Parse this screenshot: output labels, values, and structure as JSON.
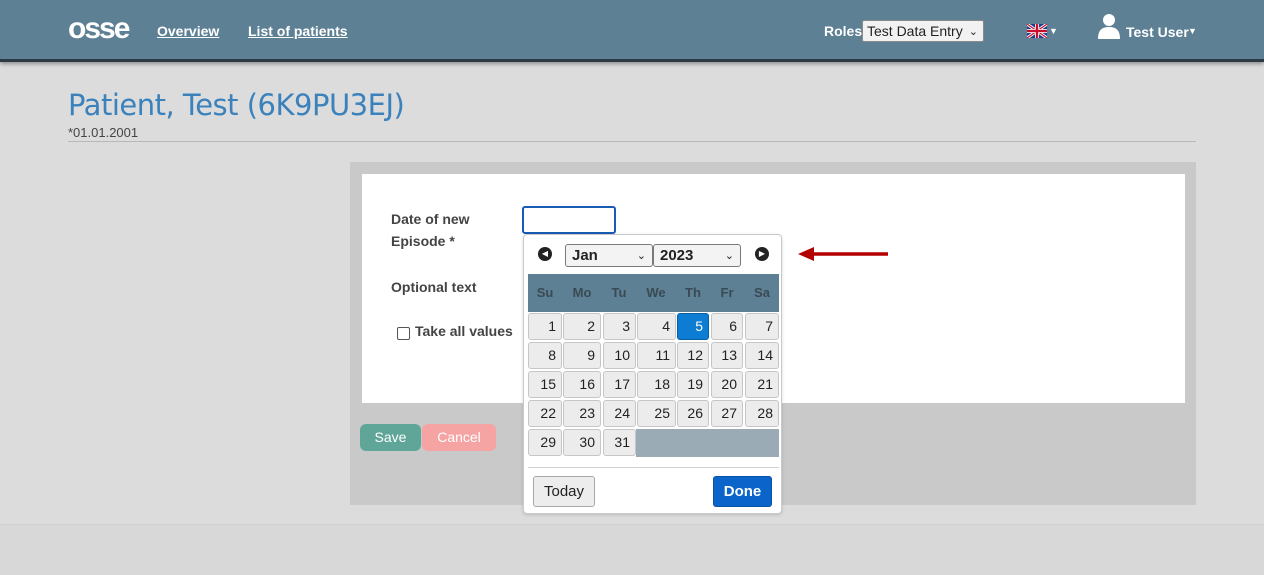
{
  "header": {
    "logo": "osse",
    "nav": [
      {
        "label": "Overview"
      },
      {
        "label": "List of patients"
      }
    ],
    "roles_label": "Roles",
    "roles_value": "Test Data Entry",
    "language_icon": "uk-flag-icon",
    "user_name": "Test User"
  },
  "patient": {
    "title": "Patient, Test (6K9PU3EJ)",
    "dob": "*01.01.2001"
  },
  "form": {
    "date_label_line1": "Date of new",
    "date_label_line2": "Episode *",
    "date_value": "",
    "optional_label": "Optional text",
    "take_all_label": "Take all values",
    "take_all_checked": false,
    "save_label": "Save",
    "cancel_label": "Cancel"
  },
  "datepicker": {
    "month": "Jan",
    "year": "2023",
    "weekdays": [
      "Su",
      "Mo",
      "Tu",
      "We",
      "Th",
      "Fr",
      "Sa"
    ],
    "days": [
      "1",
      "2",
      "3",
      "4",
      "5",
      "6",
      "7",
      "8",
      "9",
      "10",
      "11",
      "12",
      "13",
      "14",
      "15",
      "16",
      "17",
      "18",
      "19",
      "20",
      "21",
      "22",
      "23",
      "24",
      "25",
      "26",
      "27",
      "28",
      "29",
      "30",
      "31"
    ],
    "selected_day": "5",
    "today_label": "Today",
    "done_label": "Done"
  },
  "colors": {
    "header_bg": "#5e8094",
    "title_blue": "#3b82bd",
    "save_green": "#5fa698",
    "cancel_pink": "#f5a3a3",
    "selected_day": "#0c7dd2",
    "done_blue": "#0b64c9",
    "arrow_red": "#b30000"
  }
}
